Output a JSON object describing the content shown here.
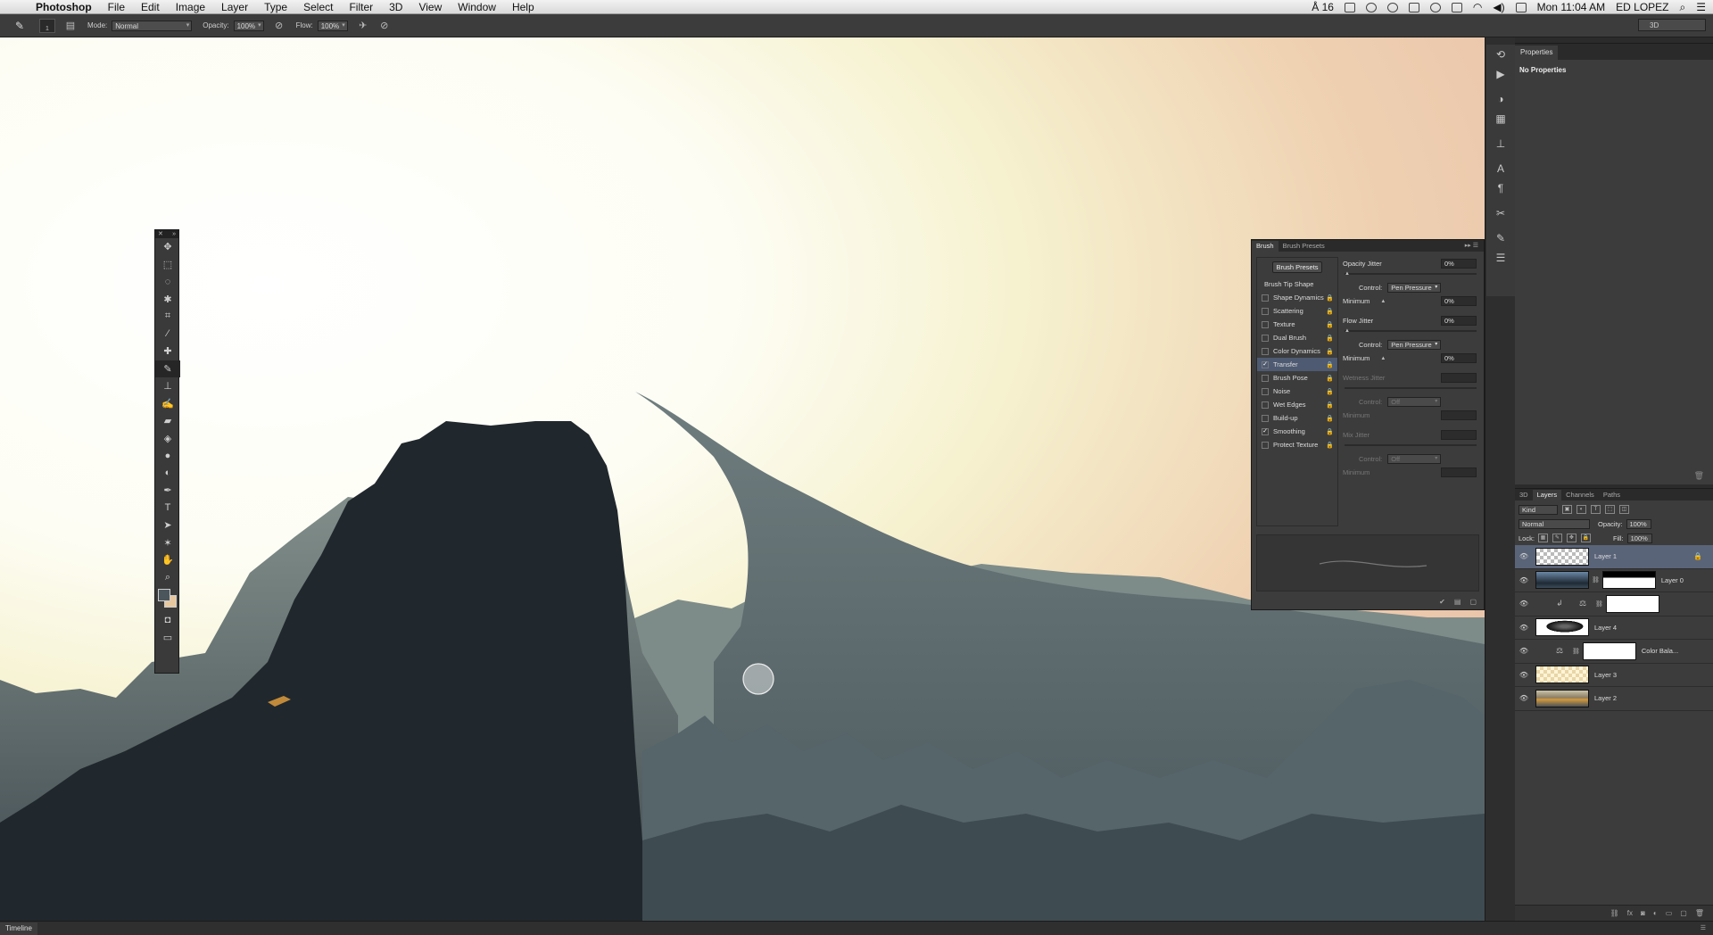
{
  "menubar": {
    "app_name": "Photoshop",
    "menus": [
      "File",
      "Edit",
      "Image",
      "Layer",
      "Type",
      "Select",
      "Filter",
      "3D",
      "View",
      "Window",
      "Help"
    ],
    "adobe_badge": "16",
    "datetime": "Mon 11:04 AM",
    "user": "ED LOPEZ"
  },
  "options_bar": {
    "brush_size": "1",
    "mode_label": "Mode:",
    "mode_value": "Normal",
    "opacity_label": "Opacity:",
    "opacity_value": "100%",
    "flow_label": "Flow:",
    "flow_value": "100%",
    "workspace": "3D"
  },
  "properties_panel": {
    "tab": "Properties",
    "title": "No Properties"
  },
  "layers_panel": {
    "tabs": [
      "3D",
      "Layers",
      "Channels",
      "Paths"
    ],
    "active_tab": "Layers",
    "kind_label": "Kind",
    "blend_mode": "Normal",
    "opacity_label": "Opacity:",
    "opacity_value": "100%",
    "lock_label": "Lock:",
    "fill_label": "Fill:",
    "fill_value": "100%",
    "layers": [
      {
        "name": "Layer 1",
        "selected": true
      },
      {
        "name": "Layer 0",
        "selected": false
      },
      {
        "name": "",
        "selected": false
      },
      {
        "name": "Layer 4",
        "selected": false
      },
      {
        "name": "Color Bala...",
        "selected": false
      },
      {
        "name": "Layer 3",
        "selected": false
      },
      {
        "name": "Layer 2",
        "selected": false
      }
    ]
  },
  "brush_panel": {
    "tabs": [
      "Brush",
      "Brush Presets"
    ],
    "presets_button": "Brush Presets",
    "tip_shape": "Brush Tip Shape",
    "options": [
      {
        "label": "Shape Dynamics",
        "checked": false,
        "active": false
      },
      {
        "label": "Scattering",
        "checked": false,
        "active": false
      },
      {
        "label": "Texture",
        "checked": false,
        "active": false
      },
      {
        "label": "Dual Brush",
        "checked": false,
        "active": false
      },
      {
        "label": "Color Dynamics",
        "checked": false,
        "active": false
      },
      {
        "label": "Transfer",
        "checked": true,
        "active": true
      },
      {
        "label": "Brush Pose",
        "checked": false,
        "active": false
      },
      {
        "label": "Noise",
        "checked": false,
        "active": false
      },
      {
        "label": "Wet Edges",
        "checked": false,
        "active": false
      },
      {
        "label": "Build-up",
        "checked": false,
        "active": false
      },
      {
        "label": "Smoothing",
        "checked": true,
        "active": false
      },
      {
        "label": "Protect Texture",
        "checked": false,
        "active": false
      }
    ],
    "opacity_jitter_label": "Opacity Jitter",
    "opacity_jitter_value": "0%",
    "control_label": "Control:",
    "pen_pressure": "Pen Pressure",
    "minimum_label": "Minimum",
    "min_value_1": "0%",
    "flow_jitter_label": "Flow Jitter",
    "flow_jitter_value": "0%",
    "min_value_2": "0%",
    "wetness_jitter_label": "Wetness Jitter",
    "off": "Off",
    "mix_jitter_label": "Mix Jitter"
  },
  "timeline": {
    "tab": "Timeline"
  },
  "colors": {
    "foreground": "#4b565c",
    "background": "#e7c89e",
    "selection": "#5a6479"
  }
}
